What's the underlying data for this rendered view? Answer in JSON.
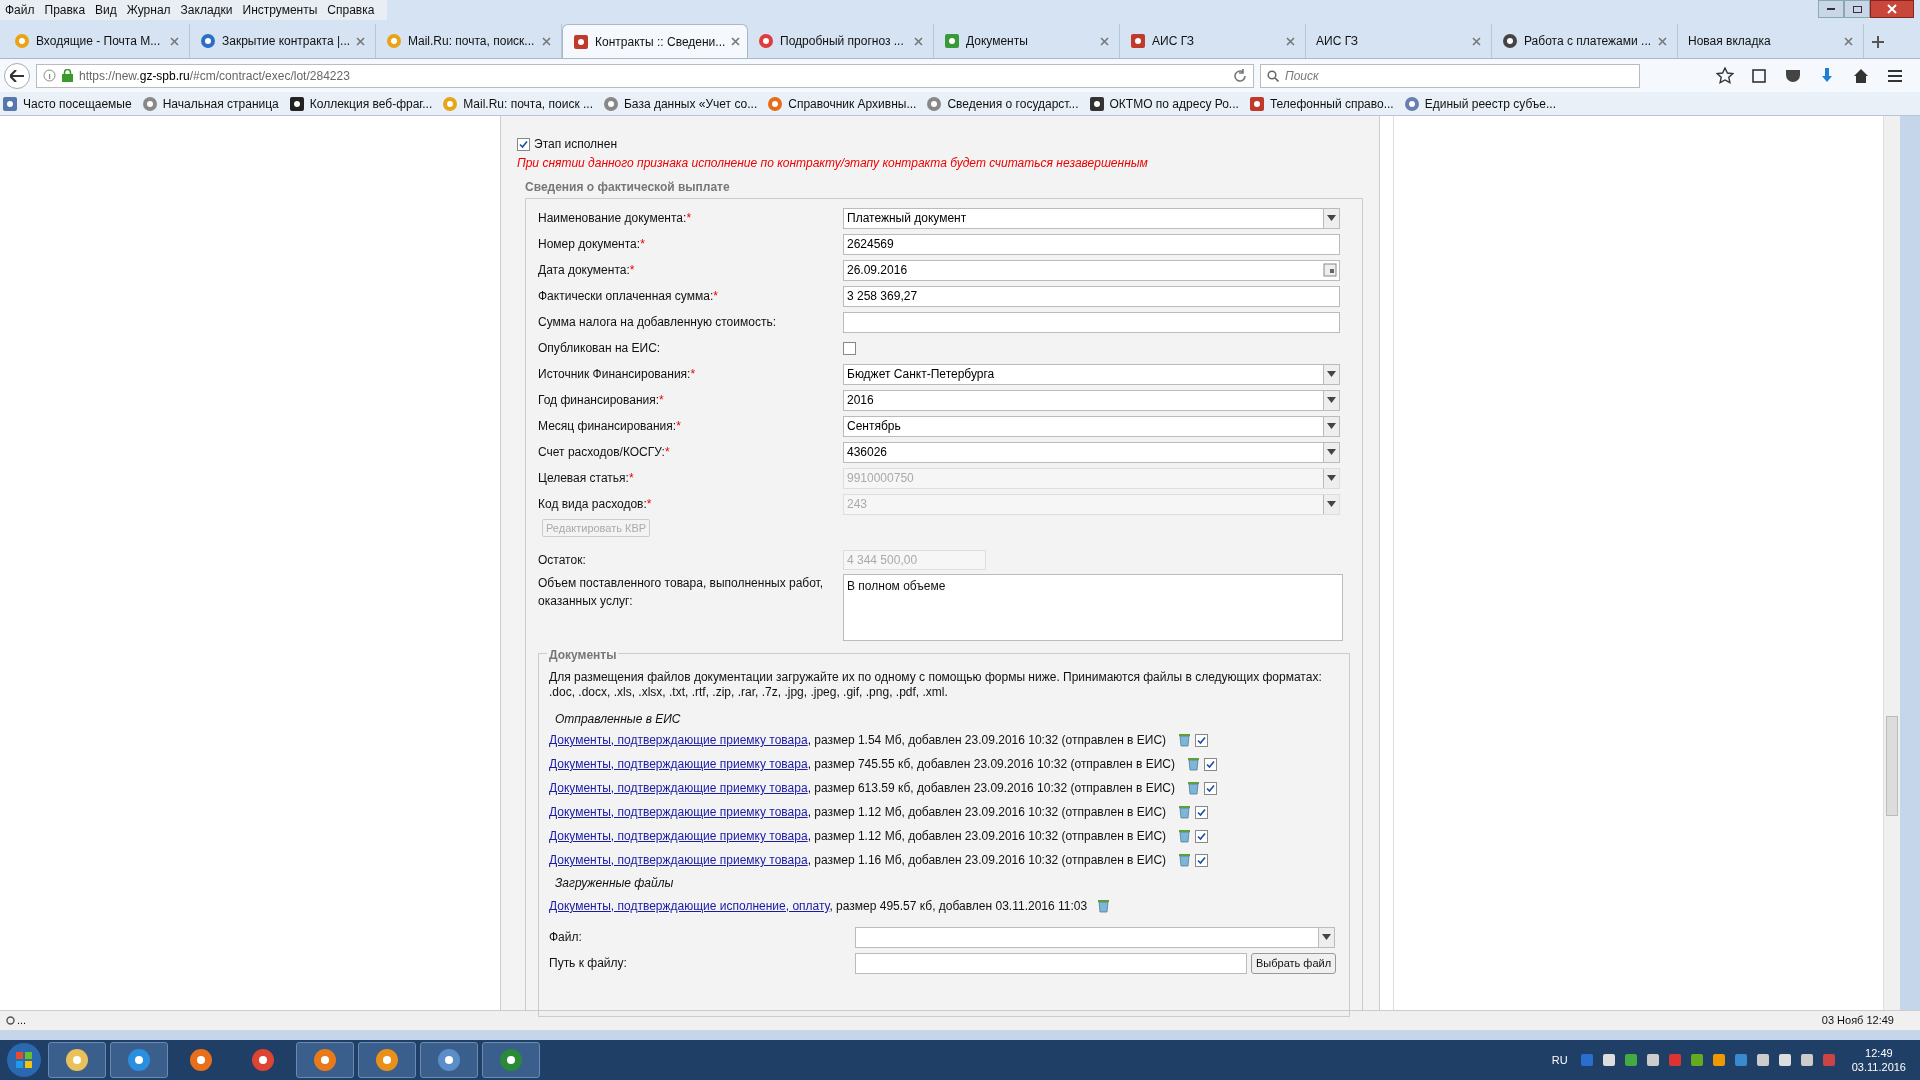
{
  "menu": [
    "Файл",
    "Правка",
    "Вид",
    "Журнал",
    "Закладки",
    "Инструменты",
    "Справка"
  ],
  "tabs": [
    {
      "label": "Входящие - Почта М...",
      "selected": false
    },
    {
      "label": "Закрытие контракта |...",
      "selected": false
    },
    {
      "label": "Mail.Ru: почта, поиск...",
      "selected": false
    },
    {
      "label": "Контракты :: Сведени...",
      "selected": true
    },
    {
      "label": "Подробный прогноз ...",
      "selected": false
    },
    {
      "label": "Документы",
      "selected": false
    },
    {
      "label": "АИС ГЗ",
      "selected": false
    },
    {
      "label": "АИС ГЗ",
      "selected": false
    },
    {
      "label": "Работа с платежами ...",
      "selected": false
    },
    {
      "label": "Новая вкладка",
      "selected": false
    }
  ],
  "address": {
    "prefix": "https://new.",
    "host": "gz-spb.ru",
    "path": "/#cm/contract/exec/lot/284223"
  },
  "search": {
    "placeholder": "Поиск"
  },
  "bookmarks": [
    "Часто посещаемые",
    "Начальная страница",
    "Коллекция веб-фраг...",
    "Mail.Ru: почта, поиск ...",
    "База данных «Учет со...",
    "Справочник Архивны...",
    "Сведения о государст...",
    "ОКТМО по адресу Ро...",
    "Телефонный справо...",
    "Единый реестр субъе..."
  ],
  "stage": {
    "label": "Этап исполнен",
    "checked": true,
    "warning": "При снятии данного признака исполнение по контракту/этапу контракта будет считаться незавершенным"
  },
  "payment": {
    "title": "Сведения о фактической выплате",
    "fields": [
      {
        "kind": "select",
        "label": "Наименование документа:",
        "mark": "*",
        "value": "Платежный документ",
        "disabled": false
      },
      {
        "kind": "text",
        "label": "Номер документа:",
        "mark": "*",
        "value": "2624569",
        "disabled": false
      },
      {
        "kind": "date",
        "label": "Дата документа:",
        "mark": "*",
        "value": "26.09.2016",
        "disabled": false
      },
      {
        "kind": "text",
        "label": "Фактически оплаченная сумма:",
        "mark": "*",
        "value": "3 258 369,27",
        "disabled": false
      },
      {
        "kind": "text",
        "label": "Сумма налога на добавленную стоимость:",
        "disabled": false
      },
      {
        "kind": "checkbox",
        "label": "Опубликован на ЕИС:",
        "checked": false
      },
      {
        "kind": "select",
        "label": "Источник Финансирования:",
        "mark": "*",
        "value": "Бюджет Санкт-Петербурга",
        "disabled": false
      },
      {
        "kind": "select",
        "label": "Год финансирования:",
        "mark": "*",
        "value": "2016",
        "disabled": false
      },
      {
        "kind": "select",
        "label": "Месяц финансирования:",
        "mark": "*",
        "value": "Сентябрь",
        "disabled": false
      },
      {
        "kind": "select",
        "label": "Счет расходов/КОСГУ:",
        "mark": "*",
        "value": "436026",
        "disabled": false
      },
      {
        "kind": "select",
        "label": "Целевая статья:",
        "mark": "*",
        "value": "9910000750",
        "disabled": true
      },
      {
        "kind": "select",
        "label": "Код вида расходов:",
        "mark": "*",
        "value": "243",
        "disabled": true
      }
    ],
    "edit_button": {
      "label": "Редактировать КВР",
      "disabled": true
    },
    "remainder": {
      "label": "Остаток:",
      "value": "4 344 500,00"
    },
    "volume": {
      "label": "Объем поставленного товара, выполненных работ, оказанных услуг:",
      "value": "В полном объеме"
    }
  },
  "documents": {
    "title": "Документы",
    "hint": "Для размещения файлов документации загружайте их по одному с помощью формы ниже. Принимаются файлы в следующих форматах: .doc, .docx, .xls, .xlsx, .txt, .rtf, .zip, .rar, .7z, .jpg, .jpeg, .gif, .png, .pdf, .xml.",
    "sent_title": "Отправленные в ЕИС",
    "sent": [
      {
        "link": "Документы, подтверждающие приемку товара",
        "info": ", размер 1.54 Мб, добавлен 23.09.2016 10:32 (отправлен в ЕИС)",
        "checked": true
      },
      {
        "link": "Документы, подтверждающие приемку товара",
        "info": ", размер 745.55 кб, добавлен 23.09.2016 10:32 (отправлен в ЕИС)",
        "checked": true
      },
      {
        "link": "Документы, подтверждающие приемку товара",
        "info": ", размер 613.59 кб, добавлен 23.09.2016 10:32 (отправлен в ЕИС)",
        "checked": true
      },
      {
        "link": "Документы, подтверждающие приемку товара",
        "info": ", размер 1.12 Мб, добавлен 23.09.2016 10:32 (отправлен в ЕИС)",
        "checked": true
      },
      {
        "link": "Документы, подтверждающие приемку товара",
        "info": ", размер 1.12 Мб, добавлен 23.09.2016 10:32 (отправлен в ЕИС)",
        "checked": true
      },
      {
        "link": "Документы, подтверждающие приемку товара",
        "info": ", размер 1.16 Мб, добавлен 23.09.2016 10:32 (отправлен в ЕИС)",
        "checked": true
      }
    ],
    "uploaded_title": "Загруженные файлы",
    "uploaded": [
      {
        "link": "Документы, подтверждающие исполнение, оплату",
        "info": ", размер 495.57 кб, добавлен 03.11.2016 11:03"
      }
    ],
    "file_label": "Файл:",
    "path_label": "Путь к файлу:",
    "choose_button": "Выбрать файл"
  },
  "status_bar": {
    "left": "...",
    "right": "03 Нояб 12:49"
  },
  "taskbar": {
    "language": "RU",
    "time": "12:49",
    "date": "03.11.2016"
  }
}
